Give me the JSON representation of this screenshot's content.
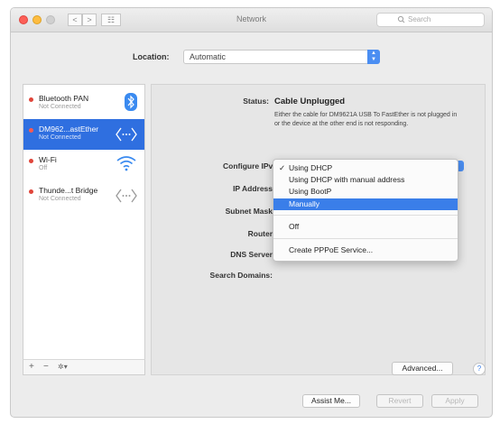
{
  "window": {
    "title": "Network"
  },
  "toolbar": {
    "back_label": "<",
    "forward_label": ">",
    "grid_label": "☷",
    "search_placeholder": "Search"
  },
  "location": {
    "label": "Location:",
    "value": "Automatic"
  },
  "services": [
    {
      "name": "Bluetooth PAN",
      "status": "Not Connected",
      "icon": "bluetooth-icon",
      "selected": false
    },
    {
      "name": "DM962...astEther",
      "status": "Not Connected",
      "icon": "ethernet-icon",
      "selected": true
    },
    {
      "name": "Wi-Fi",
      "status": "Off",
      "icon": "wifi-icon",
      "selected": false
    },
    {
      "name": "Thunde...t Bridge",
      "status": "Not Connected",
      "icon": "ethernet-icon",
      "selected": false
    }
  ],
  "sidebar_actions": {
    "add": "+",
    "remove": "−",
    "gear": "✲▾"
  },
  "detail": {
    "status_label": "Status:",
    "status_value": "Cable Unplugged",
    "status_description": "Either the cable for DM9621A USB To FastEther is not plugged in or the device at the other end is not responding.",
    "configure_label": "Configure IPv4",
    "ip_label": "IP Address",
    "subnet_label": "Subnet Mask",
    "router_label": "Router",
    "dns_label": "DNS Server",
    "search_domains_label": "Search Domains:"
  },
  "ipv4_menu": {
    "checked_index": 0,
    "highlighted_index": 3,
    "items": [
      "Using DHCP",
      "Using DHCP with manual address",
      "Using BootP",
      "Manually",
      "Off",
      "Create PPPoE Service..."
    ]
  },
  "buttons": {
    "advanced": "Advanced...",
    "help": "?",
    "assist": "Assist Me...",
    "revert": "Revert",
    "apply": "Apply"
  },
  "colors": {
    "selection": "#2f6fe0",
    "menu_highlight": "#3a7ee9",
    "status_dot": "#e0453a",
    "popup_accent": "#4b8ef2"
  }
}
